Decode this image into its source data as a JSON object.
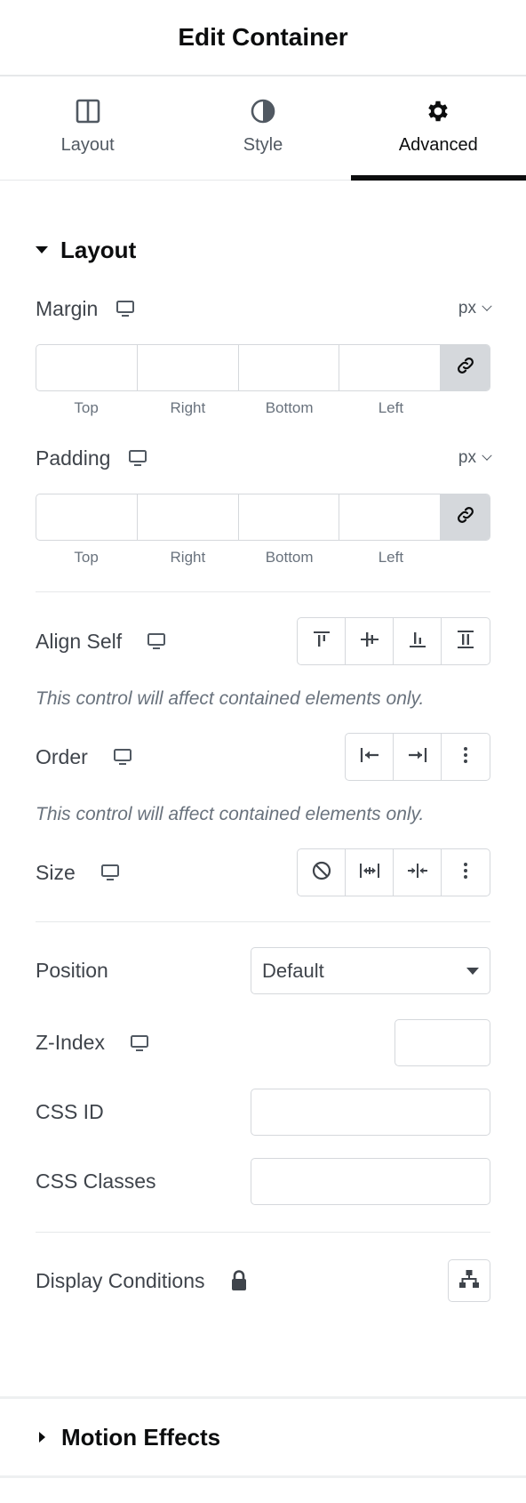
{
  "panel": {
    "title": "Edit Container"
  },
  "tabs": [
    {
      "label": "Layout",
      "icon": "columns-icon",
      "active": false
    },
    {
      "label": "Style",
      "icon": "half-circle-icon",
      "active": false
    },
    {
      "label": "Advanced",
      "icon": "gear-icon",
      "active": true
    }
  ],
  "layout_section": {
    "title": "Layout",
    "margin": {
      "label": "Margin",
      "unit": "px",
      "top": "",
      "right": "",
      "bottom": "",
      "left": ""
    },
    "padding": {
      "label": "Padding",
      "unit": "px",
      "top": "",
      "right": "",
      "bottom": "",
      "left": ""
    },
    "dim_labels": {
      "top": "Top",
      "right": "Right",
      "bottom": "Bottom",
      "left": "Left"
    },
    "align_self": {
      "label": "Align Self",
      "note": "This control will affect contained elements only."
    },
    "order": {
      "label": "Order",
      "note": "This control will affect contained elements only."
    },
    "size": {
      "label": "Size"
    },
    "position": {
      "label": "Position",
      "value": "Default"
    },
    "z_index": {
      "label": "Z-Index",
      "value": ""
    },
    "css_id": {
      "label": "CSS ID",
      "value": ""
    },
    "css_classes": {
      "label": "CSS Classes",
      "value": ""
    },
    "display_conditions": {
      "label": "Display Conditions"
    }
  },
  "motion_section": {
    "title": "Motion Effects"
  },
  "colors": {
    "text": "#3f444b",
    "heading": "#0c0d0e",
    "border": "#d5d8dc",
    "muted": "#69727d"
  }
}
